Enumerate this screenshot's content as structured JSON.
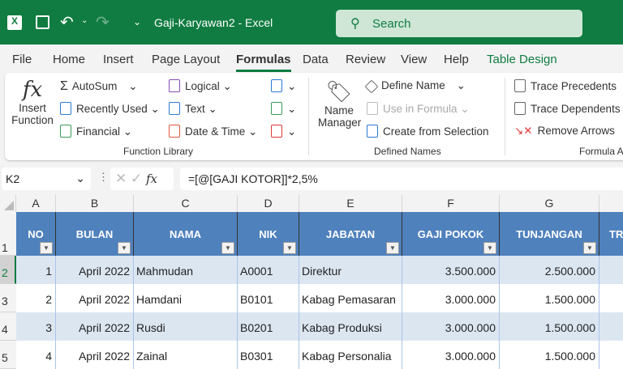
{
  "title": "Gaji-Karyawan2  -  Excel",
  "search_placeholder": "Search",
  "colors": {
    "brand": "#107c41",
    "table_header": "#4f81bd",
    "band": "#dce6f1"
  },
  "tabs": [
    "File",
    "Home",
    "Insert",
    "Page Layout",
    "Formulas",
    "Data",
    "Review",
    "View",
    "Help",
    "Table Design"
  ],
  "active_tab": "Formulas",
  "ribbon": {
    "insert_function": [
      "Insert",
      "Function"
    ],
    "autosum": "AutoSum",
    "recently_used": "Recently Used",
    "financial": "Financial",
    "logical": "Logical",
    "text": "Text",
    "date_time": "Date & Time",
    "function_library": "Function Library",
    "name_manager": [
      "Name",
      "Manager"
    ],
    "define_name": "Define Name",
    "use_in_formula": "Use in Formula",
    "create_from_selection": "Create from Selection",
    "defined_names": "Defined Names",
    "trace_precedents": "Trace Precedents",
    "trace_dependents": "Trace Dependents",
    "remove_arrows": "Remove Arrows",
    "formula_auditing": "Formula A"
  },
  "name_box": "K2",
  "formula": "=[@[GAJI KOTOR]]*2,5%",
  "columns": [
    "A",
    "B",
    "C",
    "D",
    "E",
    "F",
    "G"
  ],
  "headers": [
    "NO",
    "BULAN",
    "NAMA",
    "NIK",
    "JABATAN",
    "GAJI POKOK",
    "TUNJANGAN",
    "TR"
  ],
  "row_numbers": [
    "1",
    "2",
    "3",
    "4",
    "5"
  ],
  "rows": [
    [
      "1",
      "April 2022",
      "Mahmudan",
      "A0001",
      "Direktur",
      "3.500.000",
      "2.500.000"
    ],
    [
      "2",
      "April 2022",
      "Hamdani",
      "B0101",
      "Kabag Pemasaran",
      "3.000.000",
      "1.500.000"
    ],
    [
      "3",
      "April 2022",
      "Rusdi",
      "B0201",
      "Kabag Produksi",
      "3.000.000",
      "1.500.000"
    ],
    [
      "4",
      "April 2022",
      "Zainal",
      "B0301",
      "Kabag Personalia",
      "3.000.000",
      "1.500.000"
    ]
  ]
}
